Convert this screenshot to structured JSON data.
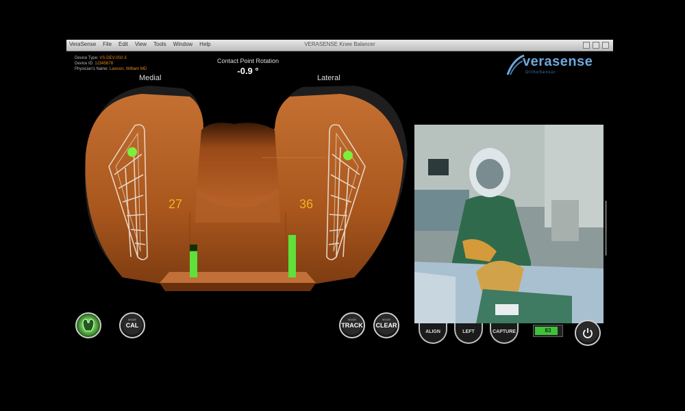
{
  "window": {
    "menu": [
      "VeraSense",
      "File",
      "Edit",
      "View",
      "Tools",
      "Window",
      "Help"
    ],
    "title": "VERASENSE Knee Balancer"
  },
  "info": [
    {
      "label": "Device Type:",
      "value": "VS-DEV-002-3"
    },
    {
      "label": "Device ID:",
      "value": "12345678"
    },
    {
      "label": "Physician's Name:",
      "value": "Lawson, William MD"
    }
  ],
  "contact_point_rotation": {
    "label": "Contact Point Rotation",
    "value": "-0.9 °"
  },
  "compartments": {
    "medial": {
      "label": "Medial",
      "load": "27",
      "bar_level": 0.8
    },
    "lateral": {
      "label": "Lateral",
      "load": "36",
      "bar_level": 1.0
    }
  },
  "logo": {
    "brand": "verasense",
    "tagline": "OrthoSensor"
  },
  "buttons": {
    "cal": "CAL",
    "track": "TRACK",
    "clear": "CLEAR",
    "align": "ALIGN",
    "left": "LEFT",
    "capture": "CAPTURE",
    "small_label": "MODE"
  },
  "battery": {
    "value": "83",
    "level": 0.83
  },
  "colors": {
    "insert": "#b35f22",
    "insert_dark": "#5e2a0c",
    "contact_point": "#7cf03a",
    "load_text": "#f2b31c",
    "accent": "#6fa8dc"
  }
}
